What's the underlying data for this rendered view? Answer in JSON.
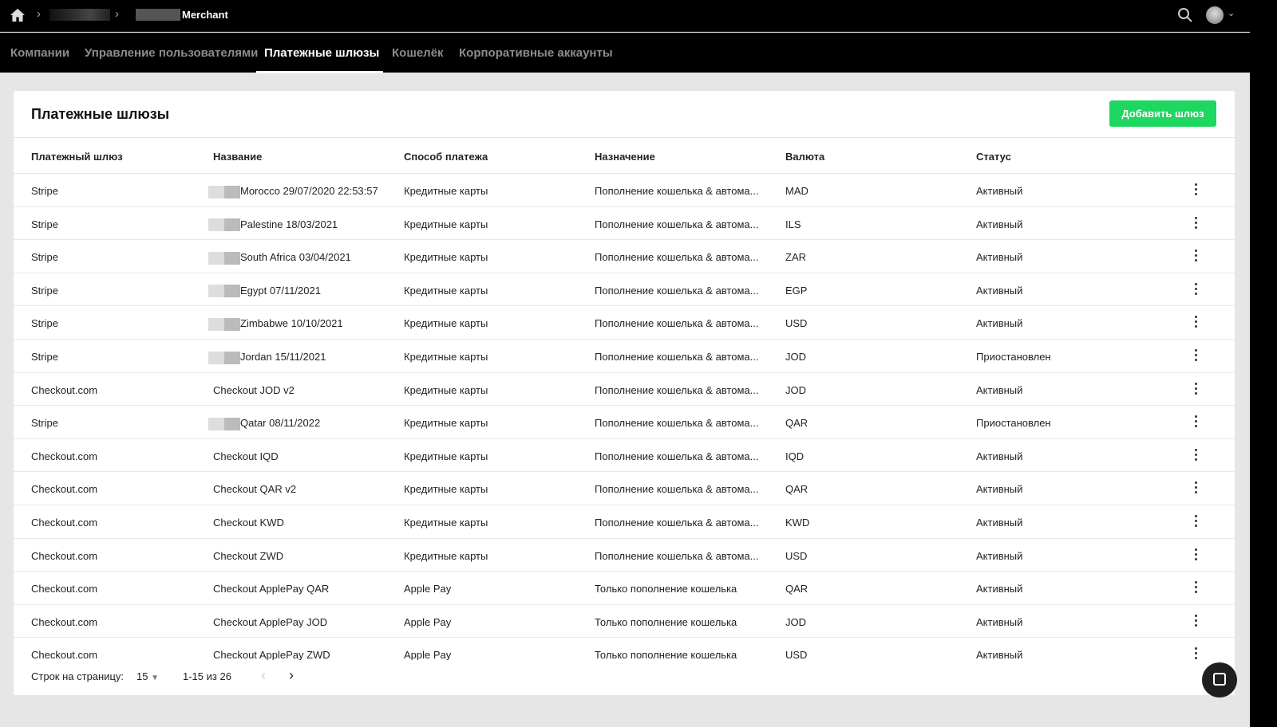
{
  "topbar": {
    "breadcrumb_current": "Merchant"
  },
  "tabs": [
    "Компании",
    "Управление пользователями",
    "Платежные шлюзы",
    "Кошелёк",
    "Корпоративные аккаунты"
  ],
  "card": {
    "title": "Платежные шлюзы",
    "add_button": "Добавить шлюз"
  },
  "columns": [
    "Платежный шлюз",
    "Название",
    "Способ платежа",
    "Назначение",
    "Валюта",
    "Статус"
  ],
  "rows": [
    [
      "Stripe",
      "Morocco 29/07/2020 22:53:57",
      "Кредитные карты",
      "Пополнение кошелька & автома...",
      "MAD",
      "Активный"
    ],
    [
      "Stripe",
      "Palestine 18/03/2021",
      "Кредитные карты",
      "Пополнение кошелька & автома...",
      "ILS",
      "Активный"
    ],
    [
      "Stripe",
      "South Africa 03/04/2021",
      "Кредитные карты",
      "Пополнение кошелька & автома...",
      "ZAR",
      "Активный"
    ],
    [
      "Stripe",
      "Egypt 07/11/2021",
      "Кредитные карты",
      "Пополнение кошелька & автома...",
      "EGP",
      "Активный"
    ],
    [
      "Stripe",
      "Zimbabwe 10/10/2021",
      "Кредитные карты",
      "Пополнение кошелька & автома...",
      "USD",
      "Активный"
    ],
    [
      "Stripe",
      "Jordan 15/11/2021",
      "Кредитные карты",
      "Пополнение кошелька & автома...",
      "JOD",
      "Приостановлен"
    ],
    [
      "Checkout.com",
      "Checkout JOD v2",
      "Кредитные карты",
      "Пополнение кошелька & автома...",
      "JOD",
      "Активный"
    ],
    [
      "Stripe",
      "Qatar 08/11/2022",
      "Кредитные карты",
      "Пополнение кошелька & автома...",
      "QAR",
      "Приостановлен"
    ],
    [
      "Checkout.com",
      "Checkout IQD",
      "Кредитные карты",
      "Пополнение кошелька & автома...",
      "IQD",
      "Активный"
    ],
    [
      "Checkout.com",
      "Checkout QAR v2",
      "Кредитные карты",
      "Пополнение кошелька & автома...",
      "QAR",
      "Активный"
    ],
    [
      "Checkout.com",
      "Checkout KWD",
      "Кредитные карты",
      "Пополнение кошелька & автома...",
      "KWD",
      "Активный"
    ],
    [
      "Checkout.com",
      "Checkout ZWD",
      "Кредитные карты",
      "Пополнение кошелька & автома...",
      "USD",
      "Активный"
    ],
    [
      "Checkout.com",
      "Checkout ApplePay QAR",
      "Apple Pay",
      "Только пополнение кошелька",
      "QAR",
      "Активный"
    ],
    [
      "Checkout.com",
      "Checkout ApplePay JOD",
      "Apple Pay",
      "Только пополнение кошелька",
      "JOD",
      "Активный"
    ],
    [
      "Checkout.com",
      "Checkout ApplePay ZWD",
      "Apple Pay",
      "Только пополнение кошелька",
      "USD",
      "Активный"
    ]
  ],
  "blurred_name_prefix": [
    true,
    true,
    true,
    true,
    true,
    true,
    false,
    true,
    false,
    false,
    false,
    false,
    false,
    false,
    false
  ],
  "pagination": {
    "rows_label": "Строк на страницу:",
    "rows_value": "15",
    "range": "1-15 из 26"
  },
  "colors": {
    "accent": "#1ed760",
    "header": "#000000"
  }
}
